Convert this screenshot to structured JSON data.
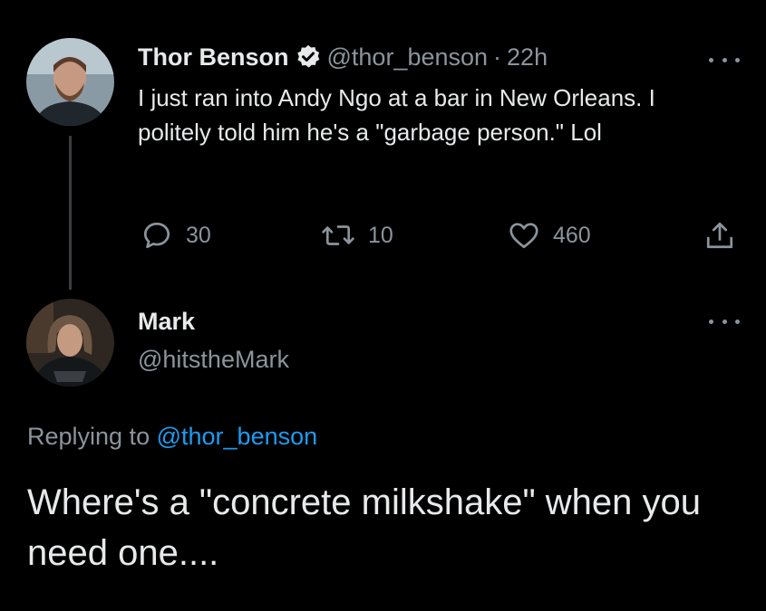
{
  "original_tweet": {
    "author_name": "Thor Benson",
    "handle": "@thor_benson",
    "separator": "·",
    "time": "22h",
    "verified_icon": "verified-badge-icon",
    "text": "I just ran into Andy Ngo at a bar in New Orleans. I politely told him he's a \"garbage person.\" Lol",
    "actions": {
      "reply_count": "30",
      "retweet_count": "10",
      "like_count": "460"
    }
  },
  "reply_tweet": {
    "author_name": "Mark",
    "handle": "@hitstheMark",
    "replying_prefix": "Replying to",
    "replying_to": "@thor_benson",
    "text": "Where's a \"concrete milkshake\" when you need one...."
  },
  "colors": {
    "background": "#000000",
    "primary_text": "#e7e9ea",
    "secondary_text": "#8b949c",
    "link": "#1d9bf0"
  }
}
